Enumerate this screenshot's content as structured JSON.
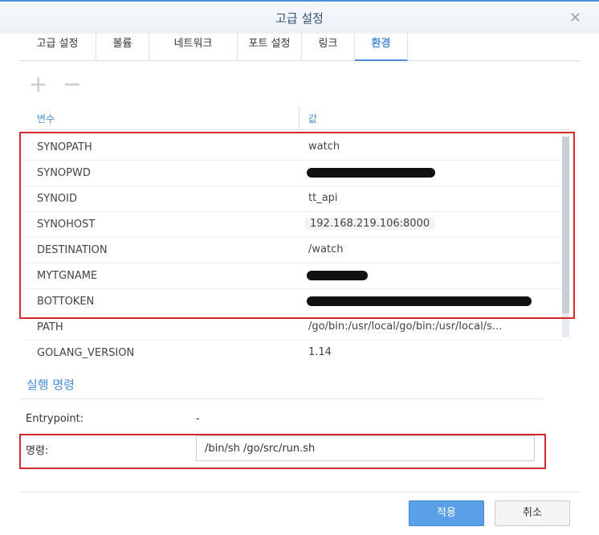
{
  "window": {
    "title": "고급 설정"
  },
  "tabs": [
    {
      "label": "고급 설정"
    },
    {
      "label": "볼륨"
    },
    {
      "label": "네트워크"
    },
    {
      "label": "포트 설정"
    },
    {
      "label": "링크"
    },
    {
      "label": "환경"
    }
  ],
  "toolbar": {
    "add_icon": "plus-icon",
    "remove_icon": "minus-icon"
  },
  "env_table": {
    "headers": {
      "variable": "변수",
      "value": "값"
    },
    "rows": [
      {
        "name": "SYNOPATH",
        "value": "watch"
      },
      {
        "name": "SYNOPWD",
        "value": "",
        "masked": true
      },
      {
        "name": "SYNOID",
        "value": "tt_api"
      },
      {
        "name": "SYNOHOST",
        "value": "192.168.219.106:8000"
      },
      {
        "name": "DESTINATION",
        "value": "/watch"
      },
      {
        "name": "MYTGNAME",
        "value": "",
        "masked": true
      },
      {
        "name": "BOTTOKEN",
        "value": "",
        "masked": true
      },
      {
        "name": "PATH",
        "value": "/go/bin:/usr/local/go/bin:/usr/local/s..."
      },
      {
        "name": "GOLANG_VERSION",
        "value": "1.14"
      }
    ]
  },
  "run_command": {
    "section_title": "실행 명령",
    "entrypoint_label": "Entrypoint:",
    "entrypoint_value": "-",
    "command_label": "명령:",
    "command_value": "/bin/sh /go/src/run.sh"
  },
  "footer": {
    "apply_label": "적용",
    "cancel_label": "취소"
  },
  "colors": {
    "accent": "#4a90d9",
    "highlight": "#d62828"
  }
}
